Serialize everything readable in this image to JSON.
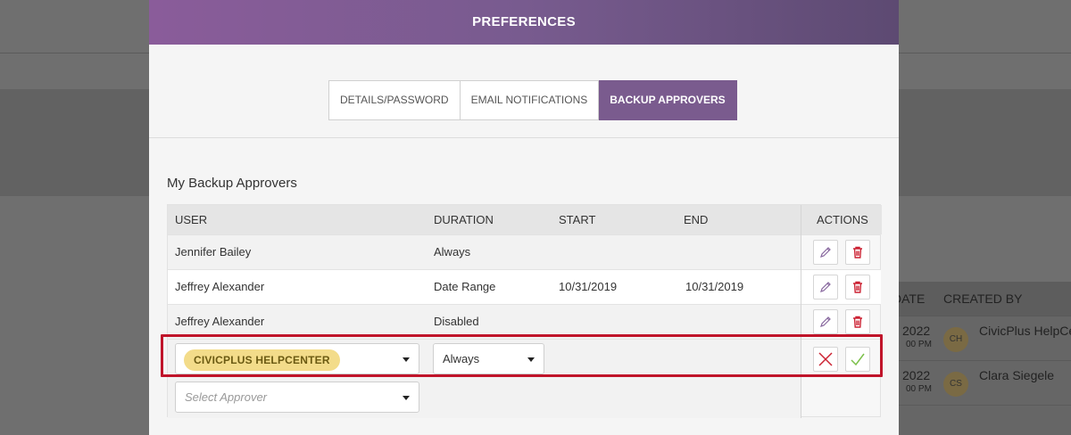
{
  "modal": {
    "title": "PREFERENCES",
    "tabs": [
      {
        "label": "DETAILS/PASSWORD",
        "active": false
      },
      {
        "label": "EMAIL NOTIFICATIONS",
        "active": false
      },
      {
        "label": "BACKUP APPROVERS",
        "active": true
      }
    ]
  },
  "section": {
    "title": "My Backup Approvers"
  },
  "table": {
    "columns": [
      "USER",
      "DURATION",
      "START",
      "END",
      "ACTIONS"
    ],
    "rows": [
      {
        "user": "Jennifer Bailey",
        "duration": "Always",
        "start": "",
        "end": ""
      },
      {
        "user": "Jeffrey Alexander",
        "duration": "Date Range",
        "start": "10/31/2019",
        "end": "10/31/2019"
      },
      {
        "user": "Jeffrey Alexander",
        "duration": "Disabled",
        "start": "",
        "end": ""
      }
    ],
    "edit_row": {
      "user_chip": "CIVICPLUS HELPCENTER",
      "duration_value": "Always"
    },
    "new_row": {
      "placeholder": "Select Approver"
    }
  },
  "background": {
    "columns": [
      "DATE",
      "CREATED BY"
    ],
    "rows": [
      {
        "date": "2022",
        "time": "00 PM",
        "initials": "CH",
        "name": "CivicPlus HelpCe"
      },
      {
        "date": "2022",
        "time": "00 PM",
        "initials": "CS",
        "name": "Clara Siegele"
      }
    ]
  },
  "colors": {
    "accent": "#7a5b8e",
    "highlight": "#c0142a",
    "chip": "#f3dc8a",
    "delete": "#cc2233",
    "confirm": "#7cc04b"
  },
  "icons": {
    "edit": "pencil-icon",
    "delete": "trash-icon",
    "cancel": "x-icon",
    "confirm": "checkmark-icon"
  }
}
